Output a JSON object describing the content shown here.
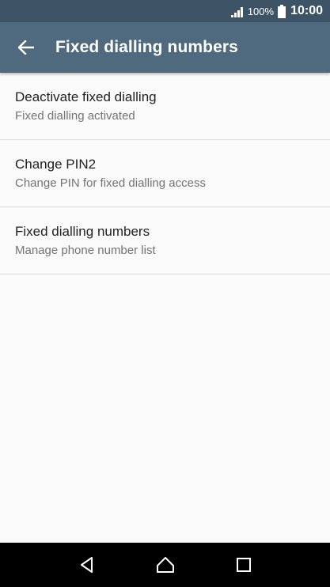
{
  "status_bar": {
    "battery_percent": "100%",
    "time": "10:00",
    "icons": [
      "signal-icon",
      "battery-icon"
    ]
  },
  "app_bar": {
    "title": "Fixed dialling numbers",
    "back_icon": "arrow-left-icon"
  },
  "settings": [
    {
      "title": "Deactivate fixed dialling",
      "subtitle": "Fixed dialling activated"
    },
    {
      "title": "Change PIN2",
      "subtitle": "Change PIN for fixed dialling access"
    },
    {
      "title": "Fixed dialling numbers",
      "subtitle": "Manage phone number list"
    }
  ],
  "nav_bar": {
    "icons": [
      "back-triangle-icon",
      "home-icon",
      "recents-icon"
    ]
  },
  "colors": {
    "status_bar": "#3d5466",
    "app_bar": "#4f6a7f",
    "background": "#fafafa",
    "nav_bar": "#000000"
  }
}
